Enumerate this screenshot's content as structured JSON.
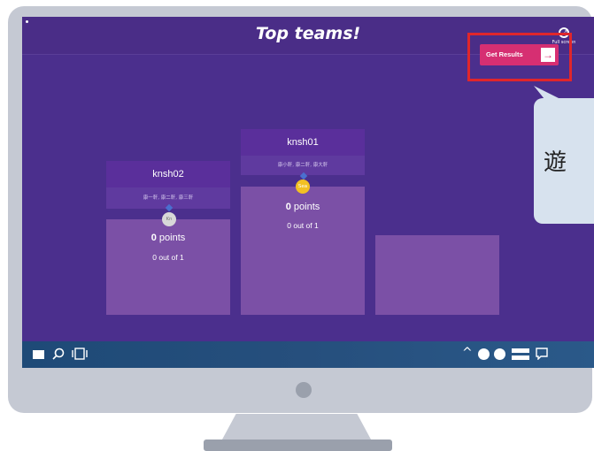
{
  "header": {
    "title": "Top teams!",
    "fullscreen_label": "Full screen"
  },
  "actions": {
    "get_results_label": "Get Results",
    "arrow_glyph": "→"
  },
  "callout": {
    "text": "遊"
  },
  "podium": [
    {
      "rank": 2,
      "team_name": "knsh02",
      "members": "康一軒, 康二軒, 康三軒",
      "medal_text": "Kn",
      "points_value": "0",
      "points_label": "points",
      "out_of": "0 out of 1"
    },
    {
      "rank": 1,
      "team_name": "knsh01",
      "members": "康小軒, 康二軒, 康大軒",
      "medal_text": "Sea",
      "points_value": "0",
      "points_label": "points",
      "out_of": "0 out of 1"
    },
    {
      "rank": 3,
      "team_name": "",
      "members": "",
      "medal_text": "",
      "points_value": "",
      "points_label": "",
      "out_of": ""
    }
  ],
  "taskbar": {
    "start_icon": "windows-start-icon",
    "search_icon": "search-icon",
    "taskview_icon": "task-view-icon",
    "chevron_glyph": "^",
    "notifications_icon": "notification-icon"
  },
  "colors": {
    "screen_bg": "#4b2f8d",
    "accent_button": "#d62f72",
    "highlight_border": "#e0262b",
    "podium_block": "#7b50a6",
    "taskbar": "#1e4a77"
  }
}
